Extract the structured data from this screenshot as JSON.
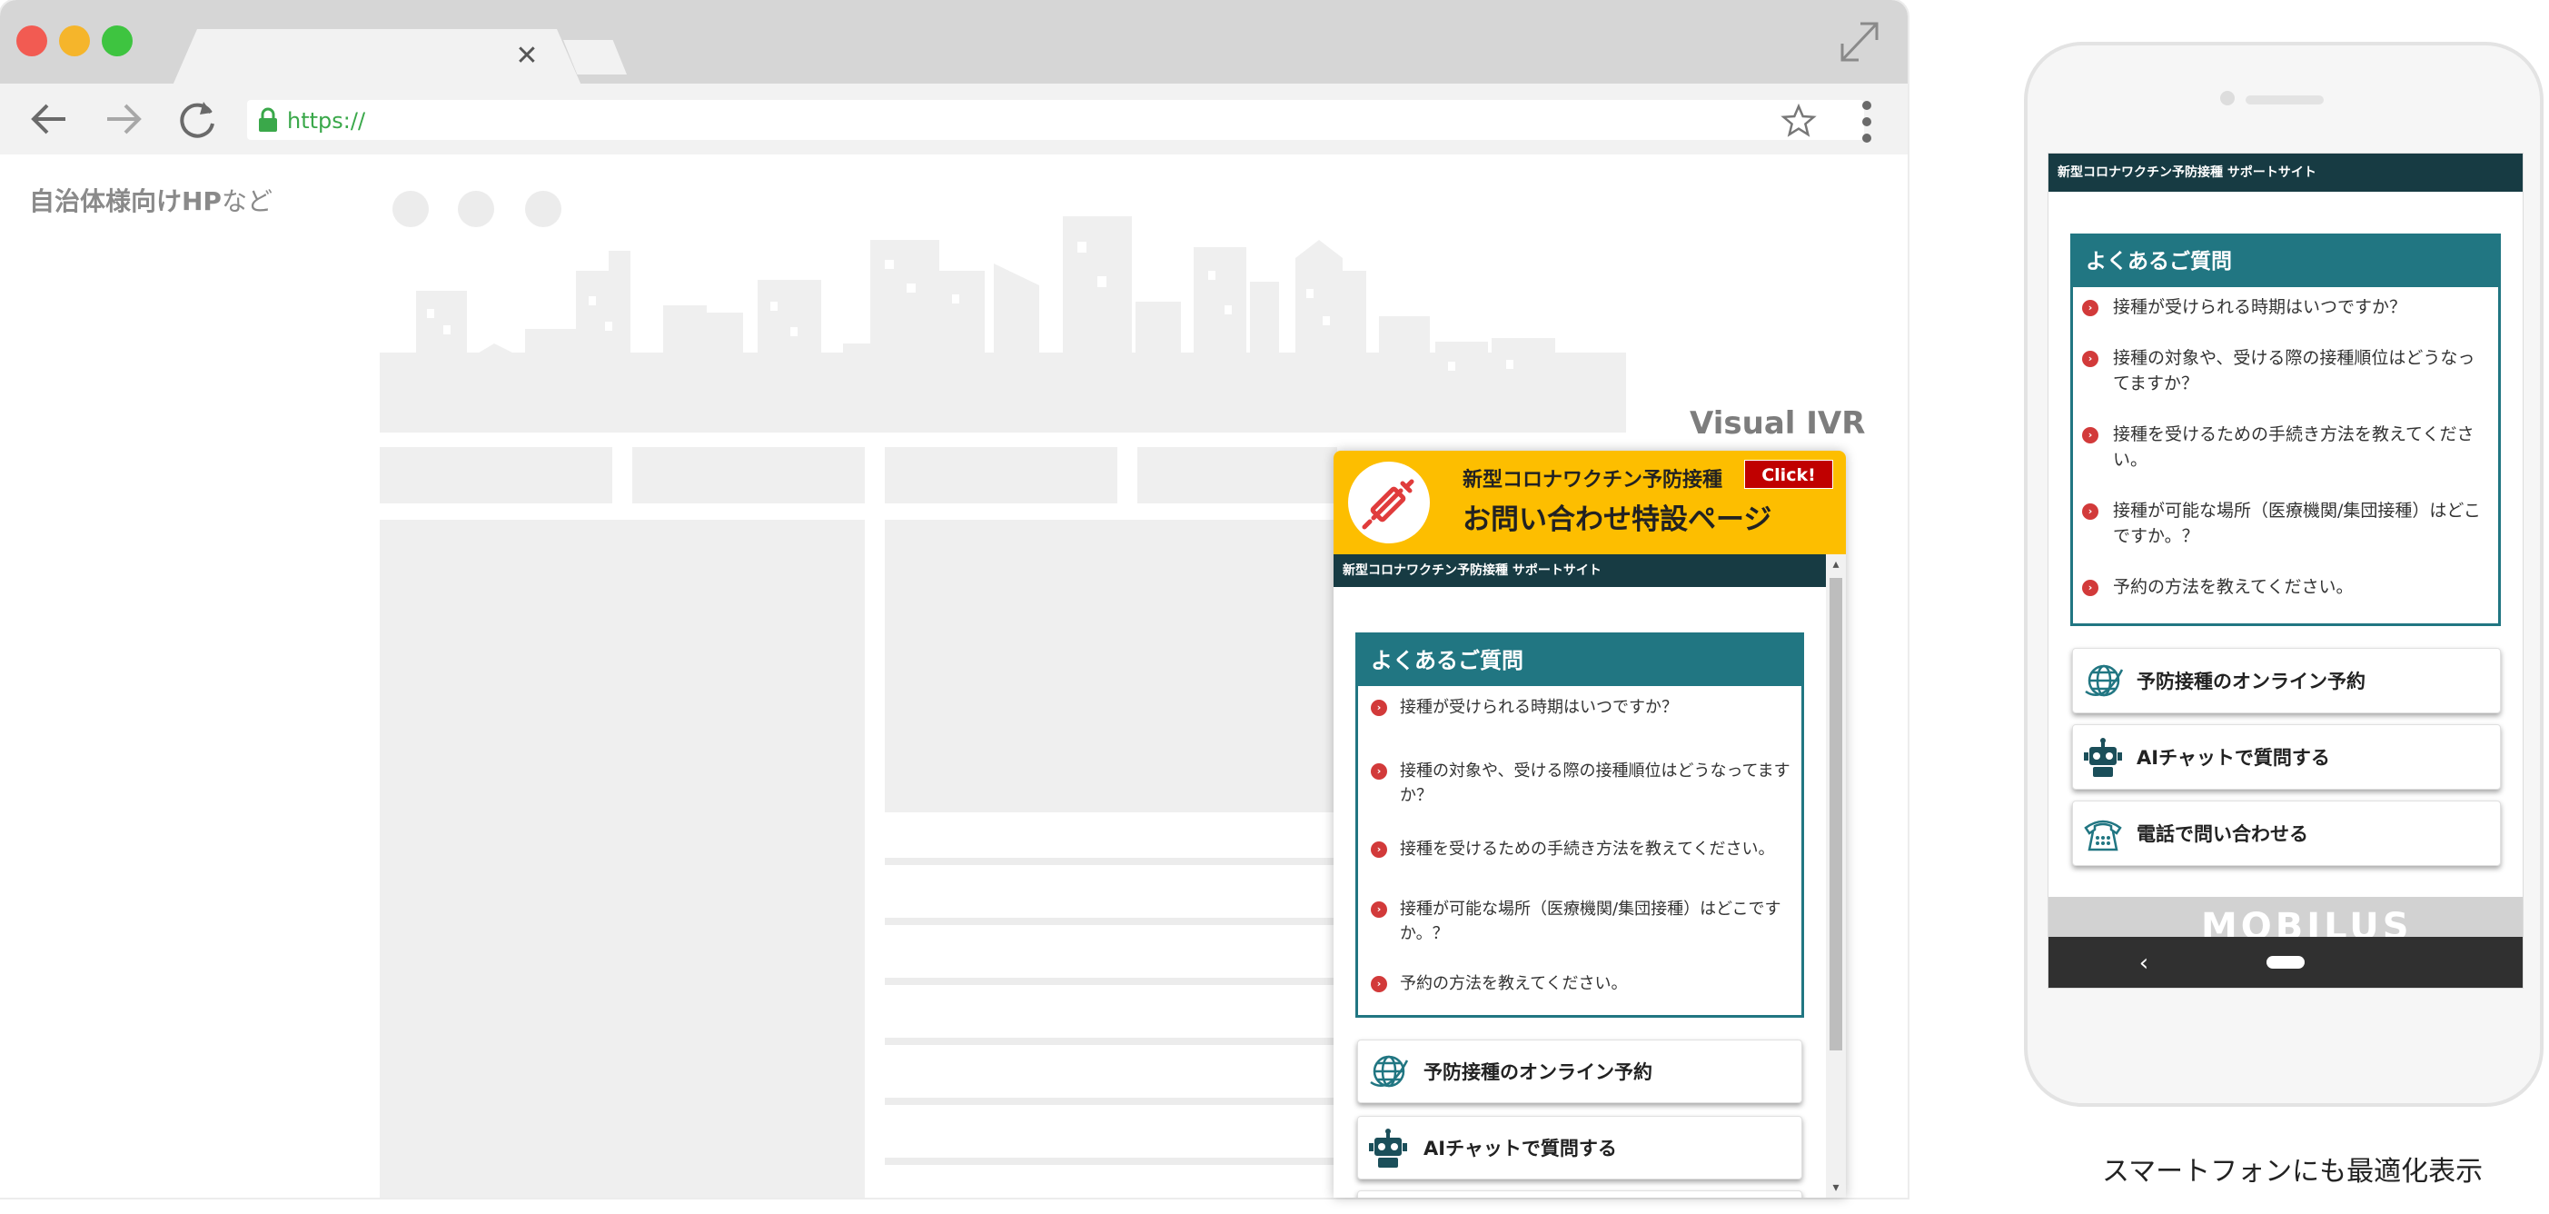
{
  "browser": {
    "url": "https://",
    "colors": {
      "close": "#f25b52",
      "minimize": "#f5b52b",
      "maximize": "#3ec440",
      "lock": "#3aa84a"
    },
    "icons": [
      "back-arrow-icon",
      "forward-arrow-icon",
      "reload-icon",
      "lock-icon",
      "star-icon",
      "kebab-menu-icon",
      "expand-icon"
    ]
  },
  "page": {
    "label": "自治体様向けHP",
    "label_suffix": "など",
    "ivr_title": "Visual IVR"
  },
  "widget": {
    "title_small": "新型コロナワクチン予防接種",
    "title_large": "お問い合わせ特設ページ",
    "click_badge": "Click!",
    "site_bar": "新型コロナワクチン予防接種 サポートサイト",
    "accent": "#fdbe00",
    "teal": "#217682"
  },
  "faq": {
    "heading": "よくあるご質問",
    "items": [
      "接種が受けられる時期はいつですか？",
      "接種の対象や、受ける際の接種順位はどうなってますか？",
      "接種を受けるための手続き方法を教えてください。",
      "接種が可能な場所（医療機関/集団接種）はどこですか。？",
      "予約の方法を教えてください。"
    ]
  },
  "buttons": {
    "online_booking": "予防接種のオンライン予約",
    "ai_chat": "AIチャットで質問する",
    "phone": "電話で問い合わせる"
  },
  "phone": {
    "site_bar": "新型コロナワクチン予防接種 サポートサイト",
    "footer_logo": "MOBILUS",
    "caption": "スマートフォンにも最適化表示"
  }
}
